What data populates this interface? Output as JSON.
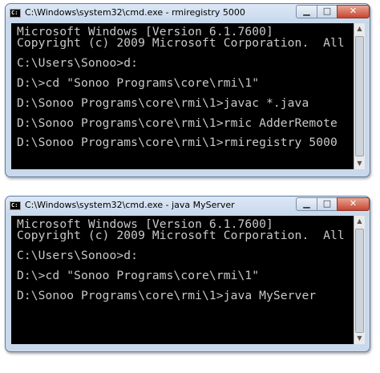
{
  "window1": {
    "title": "C:\\Windows\\system32\\cmd.exe - rmiregistry  5000",
    "lines": [
      "Microsoft Windows [Version 6.1.7600]",
      "Copyright (c) 2009 Microsoft Corporation.  All",
      "C:\\Users\\Sonoo>d:",
      "D:\\>cd \"Sonoo Programs\\core\\rmi\\1\"",
      "D:\\Sonoo Programs\\core\\rmi\\1>javac *.java",
      "D:\\Sonoo Programs\\core\\rmi\\1>rmic AdderRemote",
      "D:\\Sonoo Programs\\core\\rmi\\1>rmiregistry 5000"
    ]
  },
  "window2": {
    "title": "C:\\Windows\\system32\\cmd.exe - java  MyServer",
    "lines": [
      "Microsoft Windows [Version 6.1.7600]",
      "Copyright (c) 2009 Microsoft Corporation.  All",
      "C:\\Users\\Sonoo>d:",
      "D:\\>cd \"Sonoo Programs\\core\\rmi\\1\"",
      "D:\\Sonoo Programs\\core\\rmi\\1>java MyServer"
    ]
  },
  "controls": {
    "minimize": "▁",
    "maximize": "□",
    "close": "✕"
  },
  "icons": {
    "app": "cmd-icon",
    "scroll_up": "▲",
    "scroll_down": "▼"
  },
  "colors": {
    "console_bg": "#000000",
    "console_fg": "#c9c9c9",
    "frame": "#c9d9ec"
  }
}
